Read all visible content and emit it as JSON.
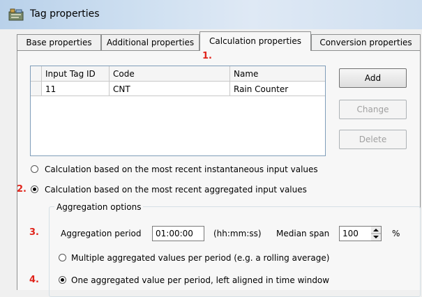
{
  "window": {
    "title": "Tag properties",
    "icon": "tag-properties-icon"
  },
  "tabs": [
    {
      "label": "Base properties",
      "active": false
    },
    {
      "label": "Additional properties",
      "active": false
    },
    {
      "label": "Calculation properties",
      "active": true
    },
    {
      "label": "Conversion properties",
      "active": false
    }
  ],
  "annotations": [
    "1.",
    "2.",
    "3.",
    "4."
  ],
  "annotation_color": "#e0241b",
  "inputs_table": {
    "columns": [
      "Input Tag ID",
      "Code",
      "Name"
    ],
    "rows": [
      {
        "id": "11",
        "code": "CNT",
        "name": "Rain Counter"
      }
    ]
  },
  "buttons": {
    "add": "Add",
    "change": "Change",
    "delete": "Delete"
  },
  "calculation_mode": {
    "instantaneous_label": "Calculation based on the most recent instantaneous input values",
    "aggregated_label": "Calculation based on the most recent aggregated input values",
    "selected": "aggregated"
  },
  "aggregation": {
    "group_title": "Aggregation options",
    "period_label": "Aggregation period",
    "period_value": "01:00:00",
    "period_format": "(hh:mm:ss)",
    "median_label": "Median span",
    "median_value": "100",
    "median_unit": "%",
    "multiple_label": "Multiple aggregated values per period (e.g. a rolling average)",
    "one_label": "One aggregated value per period, left aligned in time window",
    "selected": "one"
  }
}
